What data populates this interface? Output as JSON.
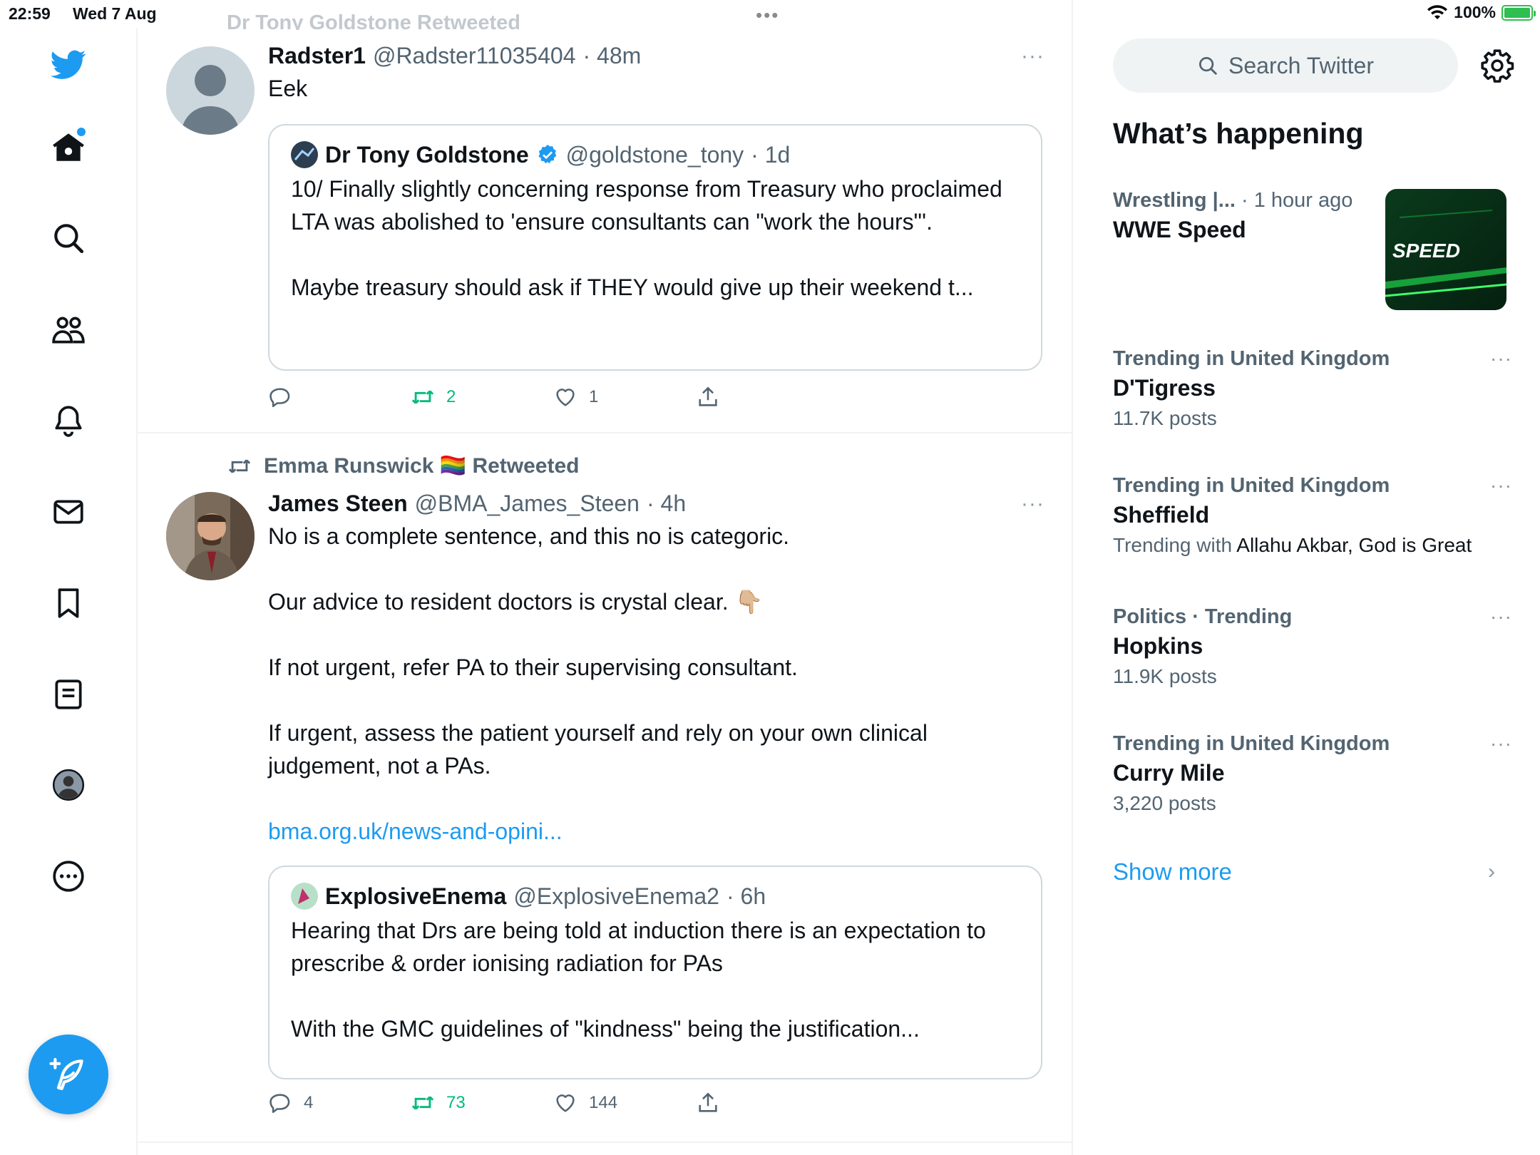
{
  "status_bar": {
    "time": "22:59",
    "date": "Wed 7 Aug",
    "battery_percent": "100%",
    "battery_level": 1.0
  },
  "nav": {
    "items": [
      "twitter-logo",
      "home-icon",
      "search-icon",
      "communities-icon",
      "notifications-icon",
      "messages-icon",
      "bookmarks-icon",
      "lists-icon",
      "profile-icon",
      "more-icon"
    ],
    "compose": "compose-icon"
  },
  "colors": {
    "accent": "#1d9bf0",
    "retweet_green": "#00ba7c",
    "secondary_text": "#536471",
    "border": "#eff3f4"
  },
  "timeline": {
    "tweet1": {
      "context_partial": "Dr Tony Goldstone Retweeted",
      "name": "Radster1",
      "handle": "@Radster11035404",
      "time": "· 48m",
      "more": "···",
      "text": "Eek",
      "quote": {
        "name": "Dr Tony Goldstone",
        "handle": "@goldstone_tony",
        "time": "· 1d",
        "text": "10/ Finally slightly concerning response from Treasury who proclaimed LTA was abolished to 'ensure consultants can \"work the hours\"'.\n\nMaybe treasury should ask if THEY would give up their weekend t..."
      },
      "actions": {
        "replies": "",
        "retweets": "2",
        "likes": "1"
      }
    },
    "tweet2": {
      "context": "Emma Runswick 🏳️‍🌈 Retweeted",
      "name": "James Steen",
      "handle": "@BMA_James_Steen",
      "time": "· 4h",
      "more": "···",
      "text": "No is a complete sentence, and this no is categoric.\n\nOur advice to resident doctors is crystal clear. 👇🏼\n\nIf not urgent, refer PA to their supervising consultant.\n\nIf urgent, assess the patient yourself and rely on your own clinical judgement, not a PAs.",
      "link": "bma.org.uk/news-and-opini...",
      "quote": {
        "name": "ExplosiveEnema",
        "handle": "@ExplosiveEnema2",
        "time": "· 6h",
        "text": "Hearing that Drs are being told at induction there is an expectation to prescribe & order ionising radiation for PAs\n\nWith the GMC guidelines of \"kindness\" being the justification..."
      },
      "actions": {
        "replies": "4",
        "retweets": "73",
        "likes": "144"
      }
    }
  },
  "sidebar": {
    "search_placeholder": "Search Twitter",
    "heading": "What’s happening",
    "trends": [
      {
        "meta": "Wrestling |...",
        "meta_light": " · 1 hour ago",
        "title": "WWE Speed",
        "sub": "",
        "thumb_label": "SPEED"
      },
      {
        "meta": "Trending in United Kingdom",
        "title": "D'Tigress",
        "sub": "11.7K posts"
      },
      {
        "meta": "Trending in United Kingdom",
        "title": "Sheffield",
        "sub_prefix": "Trending with ",
        "sub_dark": "Allahu Akbar, God is Great"
      },
      {
        "meta": "Politics · Trending",
        "title": "Hopkins",
        "sub": "11.9K posts"
      },
      {
        "meta": "Trending in United Kingdom",
        "title": "Curry Mile",
        "sub": "3,220 posts"
      }
    ],
    "show_more": "Show more",
    "more_dots": "···"
  }
}
